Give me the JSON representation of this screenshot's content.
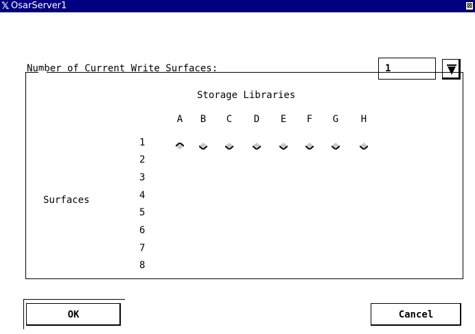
{
  "window": {
    "title": "OsarServer1",
    "close_glyph": "⊠"
  },
  "write_surfaces": {
    "label": "Number of Current Write Surfaces:",
    "value": "1"
  },
  "storage": {
    "title": "Storage Libraries",
    "columns": [
      "A",
      "B",
      "C",
      "D",
      "E",
      "F",
      "G",
      "H"
    ],
    "rows": [
      "1",
      "2",
      "3",
      "4",
      "5",
      "6",
      "7",
      "8"
    ],
    "surfaces_label": "Surfaces",
    "selected_column": "A"
  },
  "buttons": {
    "ok": "OK",
    "cancel": "Cancel"
  },
  "colors": {
    "titlebar": "#000080",
    "diamond_light": "#c8c8c8",
    "diamond_dark": "#000000"
  }
}
